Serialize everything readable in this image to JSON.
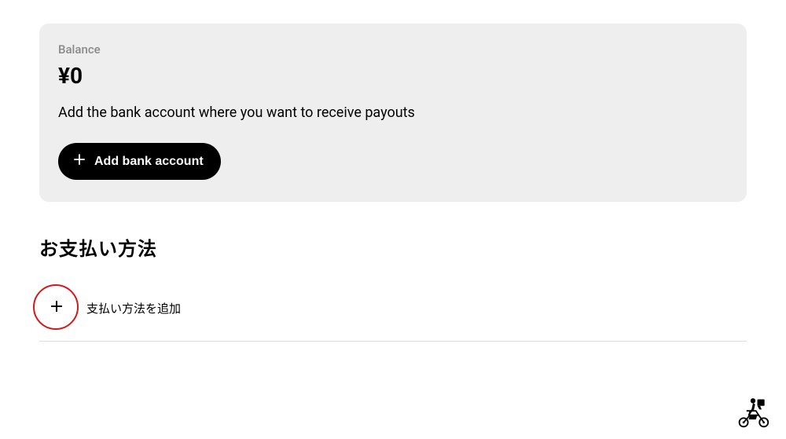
{
  "balance": {
    "label": "Balance",
    "amount": "¥0",
    "description": "Add the bank account where you want to receive payouts",
    "add_button_label": "Add bank account"
  },
  "payment_methods": {
    "section_title": "お支払い方法",
    "add_label": "支払い方法を追加"
  }
}
